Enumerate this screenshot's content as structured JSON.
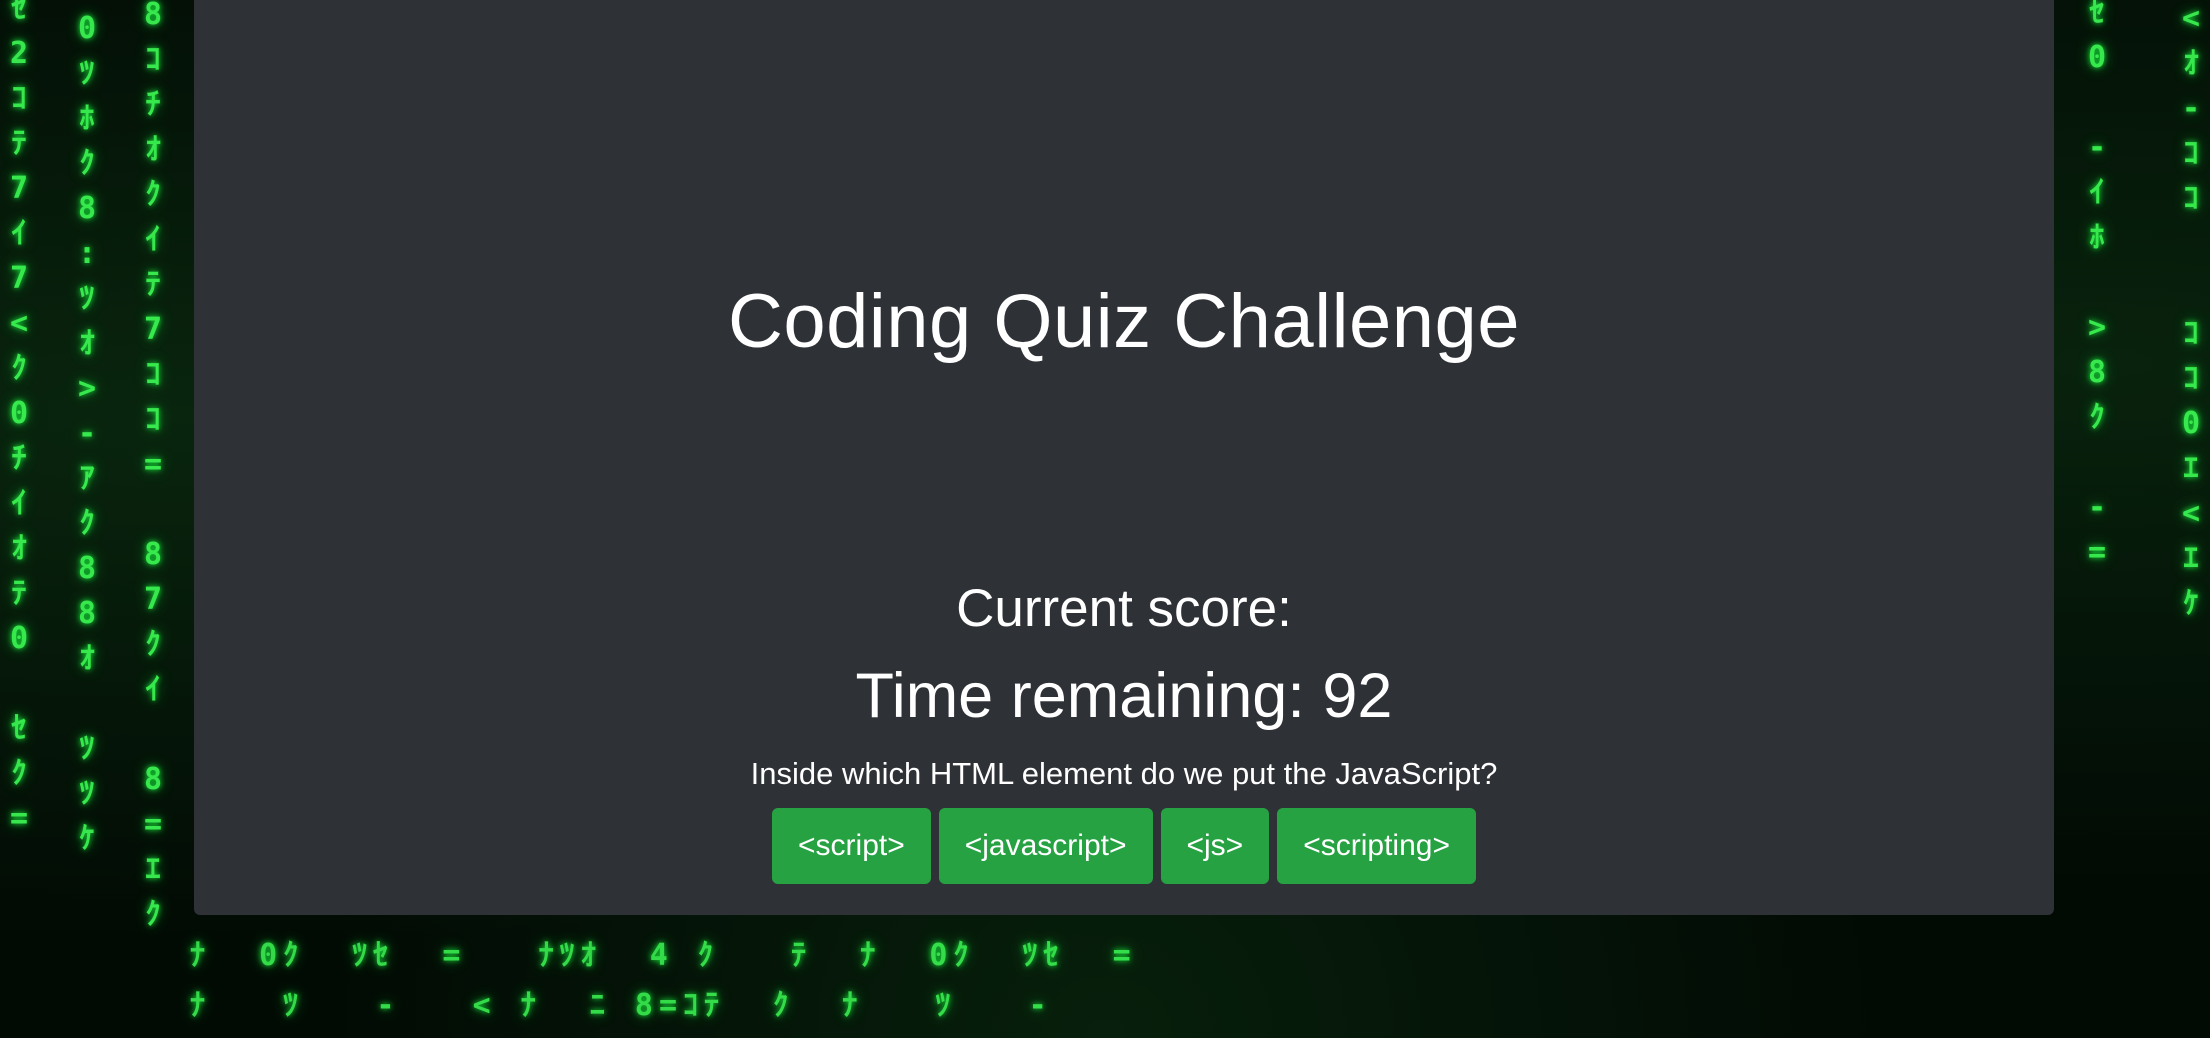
{
  "quiz": {
    "title": "Coding Quiz Challenge",
    "score_label": "Current score:",
    "time_label": "Time remaining: 92",
    "question": "Inside which HTML element do we put the JavaScript?",
    "answers": [
      "<script>",
      "<javascript>",
      "<js>",
      "<scripting>"
    ]
  },
  "colors": {
    "card_background": "#2e3136",
    "answer_button": "#27a243",
    "matrix_green": "#3dff55",
    "page_background": "#020a04"
  },
  "background": {
    "style": "matrix-code-rain",
    "columns": [
      "ｾ\n2\nｺ\nﾃ\n7\nｲ\n7\n<\nｸ\n0\nﾁ\nｲ\nｵ\nﾃ\n0\n\nｾ\nｸ\n=\n",
      "8\nｺ\nﾁ\nｵ\nｸ\nｲ\nﾃ\n7\nｺ\nｺ\n=\n\n8\n7\nｸ\nｲ\n\n8\n=\nｴ\nｸ\n",
      "0\nﾂ\nﾎ\nｸ\n8\n:\nﾂ\nｵ\n>\n-\nｱ\nｸ\n8\n8\nｵ\n\nﾂ\nﾂ\nｹ\n",
      "ｾ\n0\n\n-\nｲ\nﾎ\n\n>\n8\nｸ\n\n-\n=\n",
      "<\nｵ\n-\nｺ\nｺ\n\n\nｺ\nｺ\n0\nｴ\n<\nｴ\nｹ\n"
    ],
    "bottom_rows": [
      "ﾅ  0ｸ  ﾂｾ  =   ﾅﾂｵ  4 ｸ   ﾃ  ﾅ  0ｸ  ﾂｾ  =",
      "ﾅ   ﾂ   -   < ﾅ  ﾆ 8=ｺﾃ  ｸ  ﾅ   ﾂ   -"
    ]
  }
}
